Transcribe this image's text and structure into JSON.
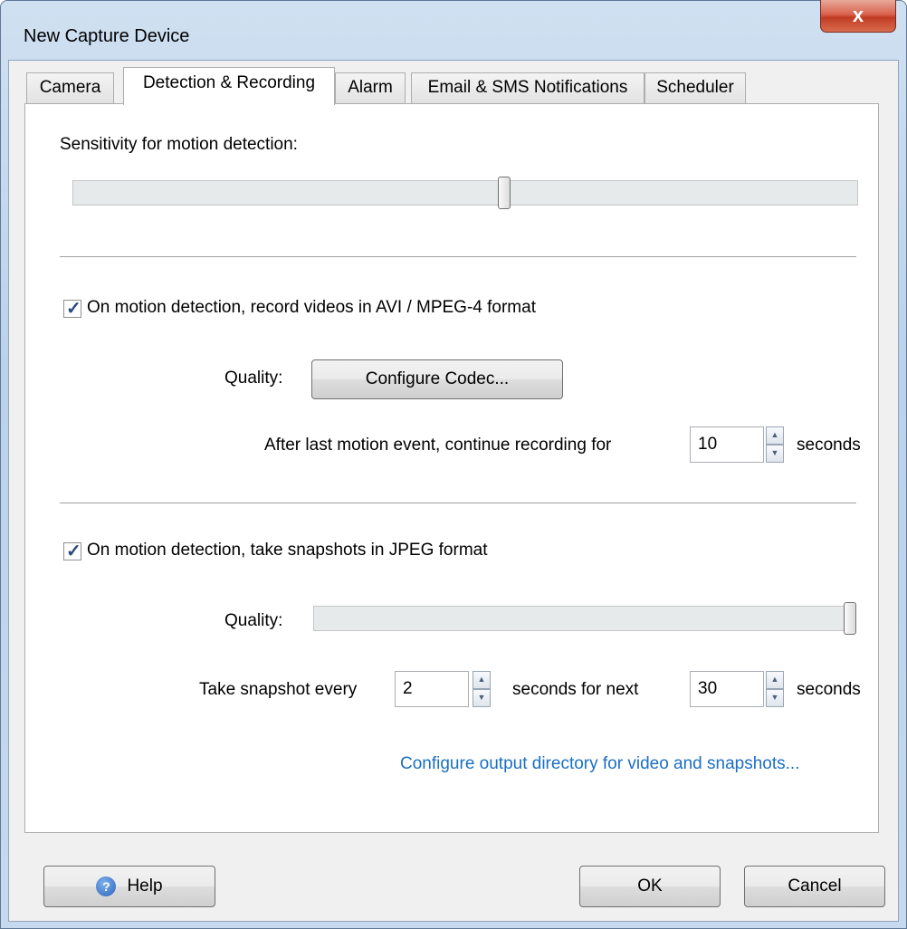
{
  "window": {
    "title": "New Capture Device",
    "close_glyph": "x"
  },
  "tabs": [
    {
      "label": "Camera"
    },
    {
      "label": "Detection & Recording"
    },
    {
      "label": "Alarm"
    },
    {
      "label": "Email & SMS Notifications"
    },
    {
      "label": "Scheduler"
    }
  ],
  "active_tab": "Detection & Recording",
  "sensitivity": {
    "label": "Sensitivity for motion detection:",
    "value_fraction": 0.55
  },
  "recording": {
    "checkbox_label": "On motion detection, record videos in AVI / MPEG-4 format",
    "checked": true,
    "quality_label": "Quality:",
    "codec_button": "Configure Codec...",
    "continue_label": "After last motion event, continue recording for",
    "continue_value": "10",
    "continue_unit": "seconds"
  },
  "snapshots": {
    "checkbox_label": "On motion detection, take snapshots in JPEG format",
    "checked": true,
    "quality_label": "Quality:",
    "quality_fraction": 1.0,
    "every_label": "Take snapshot every",
    "every_value": "2",
    "next_label": "seconds for next",
    "next_value": "30",
    "unit": "seconds"
  },
  "output_link": "Configure output directory for video and snapshots...",
  "footer": {
    "help": "Help",
    "ok": "OK",
    "cancel": "Cancel"
  },
  "icons": {
    "check": "checkmark-icon",
    "help": "help-icon",
    "close": "close-icon"
  }
}
